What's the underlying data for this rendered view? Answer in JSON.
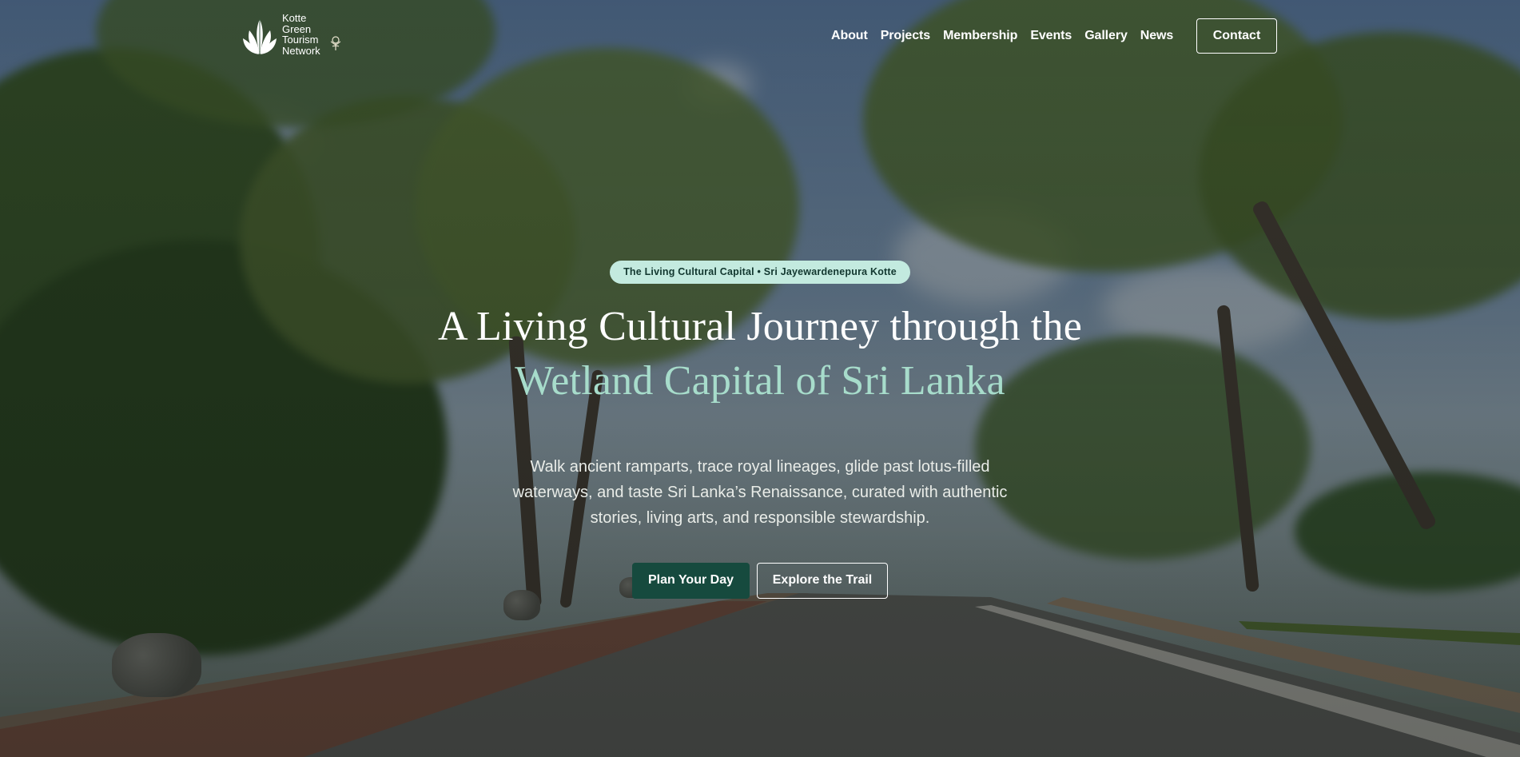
{
  "brand": {
    "logo_lines": [
      "Kotte",
      "Green",
      "Tourism",
      "Network"
    ],
    "partner_icon": "lotus-emblem-icon",
    "logo_icon": "leaf-logo-icon"
  },
  "nav": {
    "items": [
      {
        "label": "About"
      },
      {
        "label": "Projects"
      },
      {
        "label": "Membership"
      },
      {
        "label": "Events"
      },
      {
        "label": "Gallery"
      },
      {
        "label": "News"
      }
    ],
    "contact_label": "Contact"
  },
  "hero": {
    "badge": "The Living Cultural Capital • Sri Jayewardenepura Kotte",
    "headline_line1": "A Living Cultural Journey through the",
    "headline_line2": "Wetland Capital of Sri Lanka",
    "subtitle": "Walk ancient ramparts, trace royal lineages, glide past lotus-filled waterways, and taste Sri Lanka’s Renaissance, curated with authentic stories, living arts, and responsible stewardship.",
    "primary_cta": "Plan Your Day",
    "secondary_cta": "Explore the Trail"
  },
  "colors": {
    "badge_bg": "#c3eadf",
    "headline_accent": "#a7dccb",
    "primary_button": "#164a3e"
  }
}
